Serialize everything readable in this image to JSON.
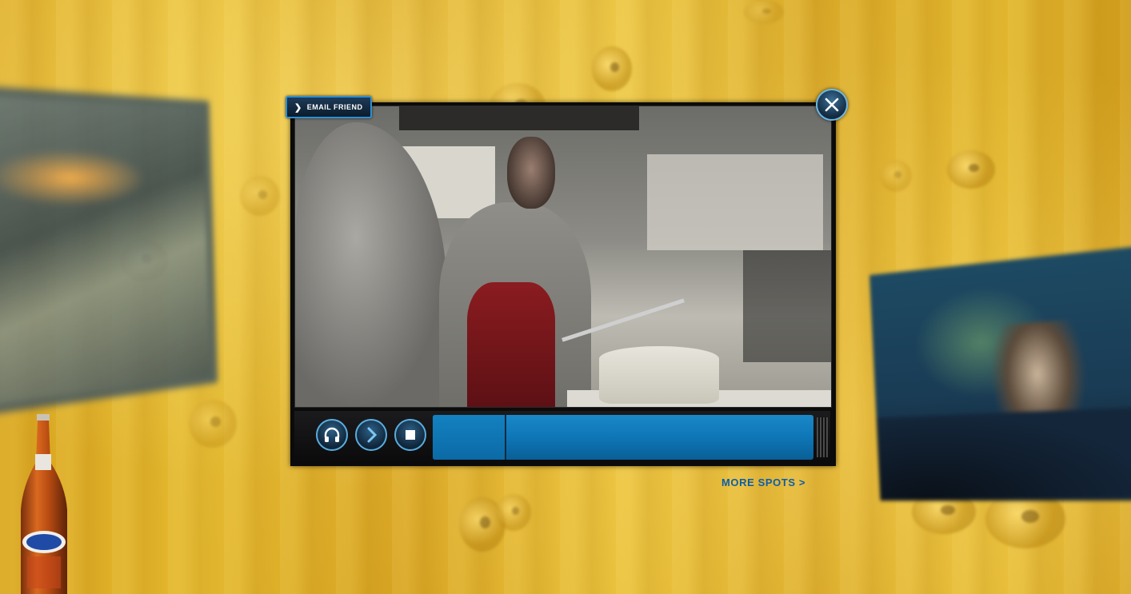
{
  "player": {
    "email_label": "Email Friend",
    "playback_progress": 0.19
  },
  "links": {
    "more_spots": "MORE SPOTS >"
  },
  "icons": {
    "email_chevron": "chevron-right-icon",
    "close": "close-icon",
    "audio": "headphones-icon",
    "play": "play-chevron-icon",
    "stop": "stop-icon"
  },
  "colors": {
    "accent_blue": "#1a88c8",
    "link_blue": "#0d5ea8",
    "background_gold": "#d9a51f"
  }
}
